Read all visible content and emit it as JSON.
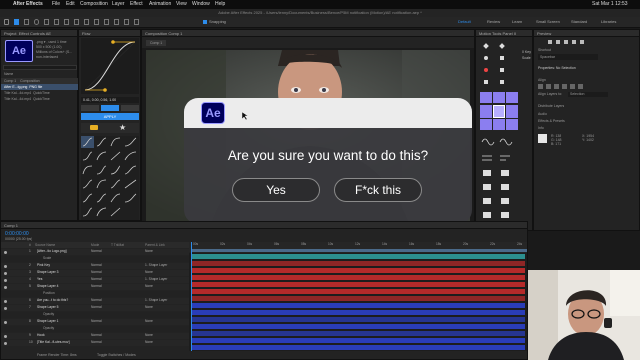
{
  "menubar": {
    "app": "After Effects",
    "items": [
      "File",
      "Edit",
      "Composition",
      "Layer",
      "Effect",
      "Animation",
      "View",
      "Window",
      "Help"
    ],
    "clock": "Sat Mar 1 12:53"
  },
  "titlebar": "Adobe After Effects 2025 - /Users/lenny/Documents/Business/Bence/P5M notification (Motion)/AE notification.aep *",
  "toolbar": {
    "snapping": "Snapping",
    "workspaces": [
      "Default",
      "Review",
      "Learn",
      "Small Screen",
      "Standard",
      "Libraries"
    ]
  },
  "project": {
    "title": "Project",
    "effect_controls": "Effect Controls AE",
    "file_info": ".png ▾ , used 1 time",
    "file_info2": "500 x 500 (1.00)",
    "file_info3": "Millions of Colors+ (S...",
    "file_info4": "non-interlaced",
    "col_name": "Name",
    "items": [
      {
        "name": "Comp 1",
        "type": "Composition"
      },
      {
        "name": "After E...tg.png",
        "type": "PNG file"
      },
      {
        "name": "Title Kal...4d.mp4",
        "type": "QuickTime"
      },
      {
        "name": "Title Kal...4d.mp4",
        "type": "QuickTime"
      }
    ]
  },
  "flow": {
    "title": "Flow",
    "values": "0.41, 0.00, 0.56, 1.00",
    "apply": "APPLY"
  },
  "composition": {
    "title": "Composition Comp 1",
    "tab": "Comp 1",
    "zoom": "100%",
    "quality": "Full",
    "timecode": "0:00:00:00"
  },
  "dialog": {
    "question": "Are you sure you want to do this?",
    "yes": "Yes",
    "no": "F*ck this"
  },
  "mtp": {
    "title": "Motion Tools Panel II",
    "ease": "0 Key",
    "scale": "Scale"
  },
  "preview": {
    "title": "Preview",
    "shortcut_label": "Shortcut",
    "shortcut": "Spacebar"
  },
  "properties": {
    "title": "Properties: No Selection",
    "align": "Align",
    "align_to": "Align Layers to:",
    "selection": "Selection",
    "distribute": "Distribute Layers",
    "audio": "Audio",
    "effects": "Effects & Presets",
    "info": "Info",
    "r": "R: 138",
    "g": "G: 148",
    "b": "B: 171",
    "x": "X: 1954",
    "y": "Y: 1402"
  },
  "timeline": {
    "title": "Comp 1",
    "timecode": "0:00:00:00",
    "fps": "00000 (25.00 fps)",
    "cols": [
      "#",
      "Source Name",
      "Mode",
      "T TrkMat",
      "Parent & Link"
    ],
    "ruler": [
      "00s",
      "02s",
      "04s",
      "06s",
      "08s",
      "10s",
      "12s",
      "14s",
      "16s",
      "18s",
      "20s",
      "22s",
      "24s"
    ],
    "layers": [
      {
        "n": "1",
        "name": "[After...tio Logo.png]",
        "mode": "Normal",
        "parent": "None"
      },
      {
        "n": "",
        "name": "Scale",
        "mode": "",
        "parent": ""
      },
      {
        "n": "2",
        "name": "Pink Key",
        "mode": "Normal",
        "parent": "1. Shape Layer"
      },
      {
        "n": "3",
        "name": "Shape Layer 3",
        "mode": "Normal",
        "parent": "None"
      },
      {
        "n": "4",
        "name": "Yes",
        "mode": "Normal",
        "parent": "1. Shape Layer"
      },
      {
        "n": "5",
        "name": "Shape Layer 4",
        "mode": "Normal",
        "parent": "None"
      },
      {
        "n": "",
        "name": "Position",
        "mode": "",
        "parent": ""
      },
      {
        "n": "6",
        "name": "Are you...t to do this?",
        "mode": "Normal",
        "parent": "1. Shape Layer"
      },
      {
        "n": "7",
        "name": "Shape Layer 5",
        "mode": "Normal",
        "parent": "None"
      },
      {
        "n": "",
        "name": "Opacity",
        "mode": "",
        "parent": ""
      },
      {
        "n": "8",
        "name": "Shape Layer 1",
        "mode": "Normal",
        "parent": "None"
      },
      {
        "n": "",
        "name": "Opacity",
        "mode": "",
        "parent": ""
      },
      {
        "n": "9",
        "name": "Hook",
        "mode": "Normal",
        "parent": "None"
      },
      {
        "n": "10",
        "name": "[Title Kal...fLutes.mov]",
        "mode": "Normal",
        "parent": "None"
      }
    ],
    "footer": "Frame Render Time: 8ms",
    "toggle": "Toggle Switches / Modes"
  },
  "colors": {
    "accent": "#2d8ceb",
    "ae_blue": "#00005b",
    "ae_purple": "#9999ff",
    "track_red": "#b42a2a",
    "track_blue": "#2a3db8",
    "track_teal": "#2c8f8f"
  }
}
